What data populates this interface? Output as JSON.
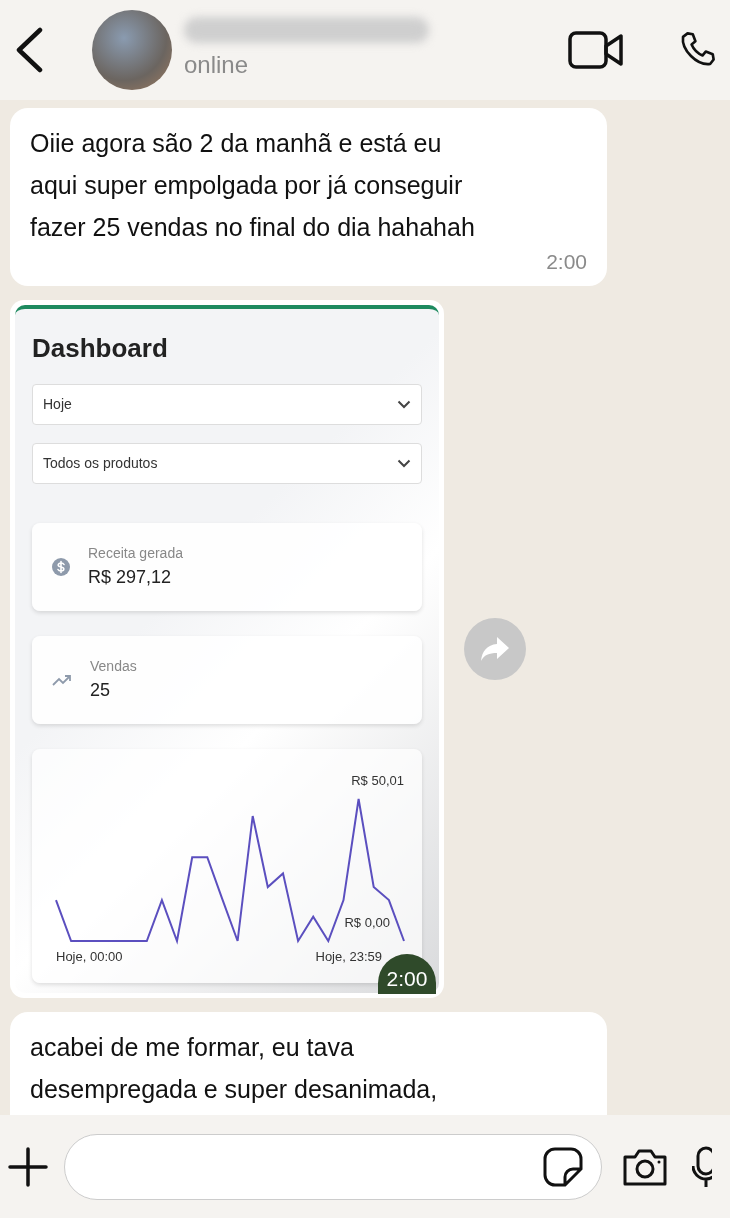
{
  "header": {
    "status": "online"
  },
  "messages": [
    {
      "kind": "text",
      "lines": [
        "Oiie agora são 2 da manhã e está eu",
        "aqui super empolgada por já conseguir",
        "fazer 25 vendas no final do dia hahahah"
      ],
      "time": "2:00"
    },
    {
      "kind": "image",
      "time": "2:00",
      "dashboard": {
        "title": "Dashboard",
        "filters": [
          {
            "value": "Hoje"
          },
          {
            "value": "Todos os produtos"
          }
        ],
        "stats": [
          {
            "kind": "money",
            "label": "Receita gerada",
            "value": "R$ 297,12"
          },
          {
            "kind": "trend",
            "label": "Vendas",
            "value": "25"
          }
        ],
        "chart": {
          "max_label": "R$ 50,01",
          "min_label": "R$ 0,00",
          "start_label": "Hoje, 00:00",
          "end_label": "Hoje, 23:59"
        }
      }
    },
    {
      "kind": "text",
      "lines": [
        "acabei de me formar, eu tava",
        "desempregada e super desanimada,"
      ]
    }
  ]
}
